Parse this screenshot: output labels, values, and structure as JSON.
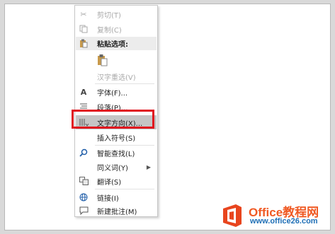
{
  "menu": {
    "cut": "剪切(T)",
    "copy": "复制(C)",
    "paste_options": "粘贴选项:",
    "reconvert": "汉字重选(V)",
    "font": "字体(F)...",
    "paragraph": "段落(P)...",
    "text_direction": "文字方向(X)...",
    "insert_symbol": "插入符号(S)",
    "smart_lookup": "智能查找(L)",
    "synonyms": "同义词(Y)",
    "translate": "翻译(S)",
    "link": "链接(I)",
    "new_comment": "新建批注(M)"
  },
  "watermark": {
    "brand": "Office教程网",
    "url": "www.office26.com",
    "brand_color": "#f05a24",
    "url_color": "#1f6fb6"
  },
  "highlight_color": "#e0141e"
}
